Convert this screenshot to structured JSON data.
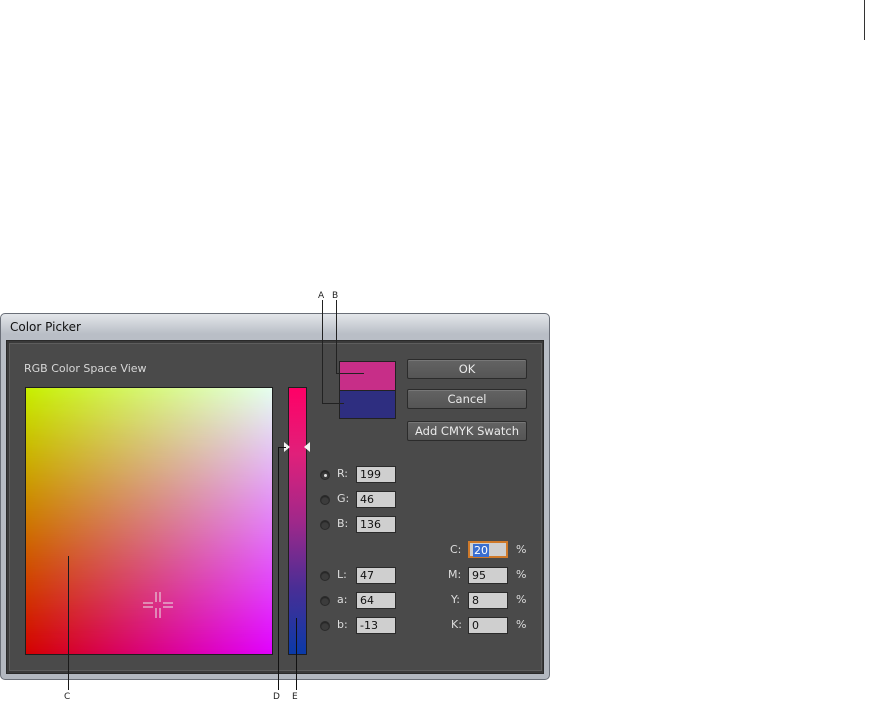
{
  "callouts": {
    "a": "A",
    "b": "B",
    "c": "C",
    "d": "D",
    "e": "E"
  },
  "window": {
    "title": "Color Picker"
  },
  "view_label": "RGB Color Space View",
  "buttons": {
    "ok": "OK",
    "cancel": "Cancel",
    "add_swatch": "Add CMYK Swatch"
  },
  "swatches": {
    "new_color": "#c72e88",
    "original_color": "#2e2e80"
  },
  "rgb": {
    "r": {
      "label": "R:",
      "value": "199",
      "selected": true
    },
    "g": {
      "label": "G:",
      "value": "46",
      "selected": false
    },
    "b": {
      "label": "B:",
      "value": "136",
      "selected": false
    }
  },
  "lab": {
    "l": {
      "label": "L:",
      "value": "47"
    },
    "a": {
      "label": "a:",
      "value": "64"
    },
    "b": {
      "label": "b:",
      "value": "-13"
    }
  },
  "cmyk": {
    "c": {
      "label": "C:",
      "value": "20",
      "unit": "%"
    },
    "m": {
      "label": "M:",
      "value": "95",
      "unit": "%"
    },
    "y": {
      "label": "Y:",
      "value": "8",
      "unit": "%"
    },
    "k": {
      "label": "K:",
      "value": "0",
      "unit": "%"
    }
  },
  "icons": {
    "crosshair": "crosshair-icon",
    "slider_arrows": "triangle-icon"
  }
}
